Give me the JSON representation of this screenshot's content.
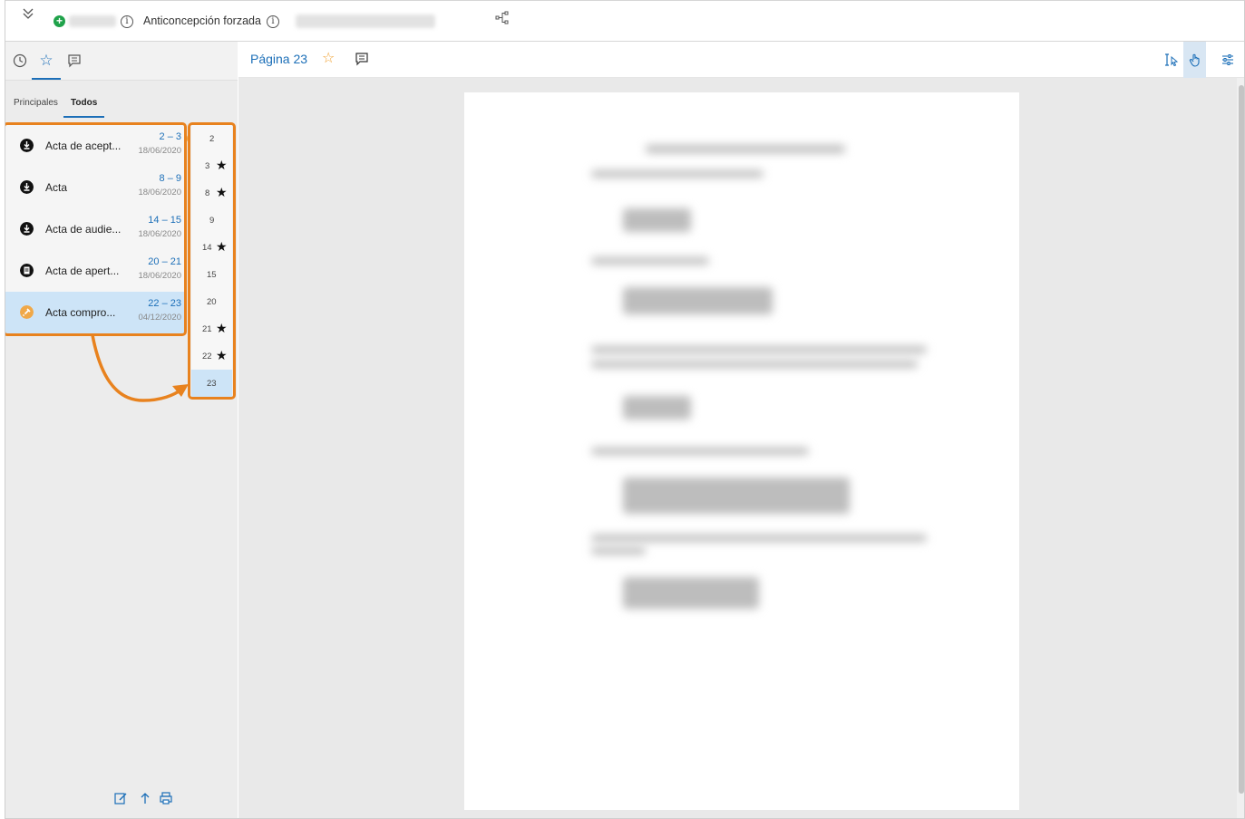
{
  "topbar": {
    "title": "Anticoncepción forzada",
    "info_glyph": "i",
    "plus_glyph": "+"
  },
  "left_tabs": {
    "active": "favorites"
  },
  "subtabs": {
    "principales": "Principales",
    "todos": "Todos"
  },
  "toolbar_glyphs": {
    "add": "+",
    "remove": "−",
    "more": "•••"
  },
  "bookmarks": [
    {
      "name": "Acta de acept...",
      "range": "2 – 3",
      "date": "18/06/2020",
      "icon": "download-icon"
    },
    {
      "name": "Acta",
      "range": "8 – 9",
      "date": "18/06/2020",
      "icon": "download-icon"
    },
    {
      "name": "Acta de audie...",
      "range": "14 – 15",
      "date": "18/06/2020",
      "icon": "download-icon"
    },
    {
      "name": "Acta de apert...",
      "range": "20 – 21",
      "date": "18/06/2020",
      "icon": "document-icon"
    },
    {
      "name": "Acta compro...",
      "range": "22 – 23",
      "date": "04/12/2020",
      "icon": "pin-icon"
    }
  ],
  "pages": [
    {
      "num": "2",
      "starred": false
    },
    {
      "num": "3",
      "starred": true
    },
    {
      "num": "8",
      "starred": true
    },
    {
      "num": "9",
      "starred": false
    },
    {
      "num": "14",
      "starred": true
    },
    {
      "num": "15",
      "starred": false
    },
    {
      "num": "20",
      "starred": false
    },
    {
      "num": "21",
      "starred": true
    },
    {
      "num": "22",
      "starred": true
    },
    {
      "num": "23",
      "starred": false
    }
  ],
  "star_glyph": "★",
  "outline_star_glyph": "☆",
  "viewer": {
    "page_label": "Página 23"
  },
  "colors": {
    "accent": "#1c6fb8",
    "highlight": "#e8821e",
    "selection": "#cde4f7",
    "add": "#1fa24a",
    "remove": "#e24a4a",
    "pin": "#f0a848"
  }
}
